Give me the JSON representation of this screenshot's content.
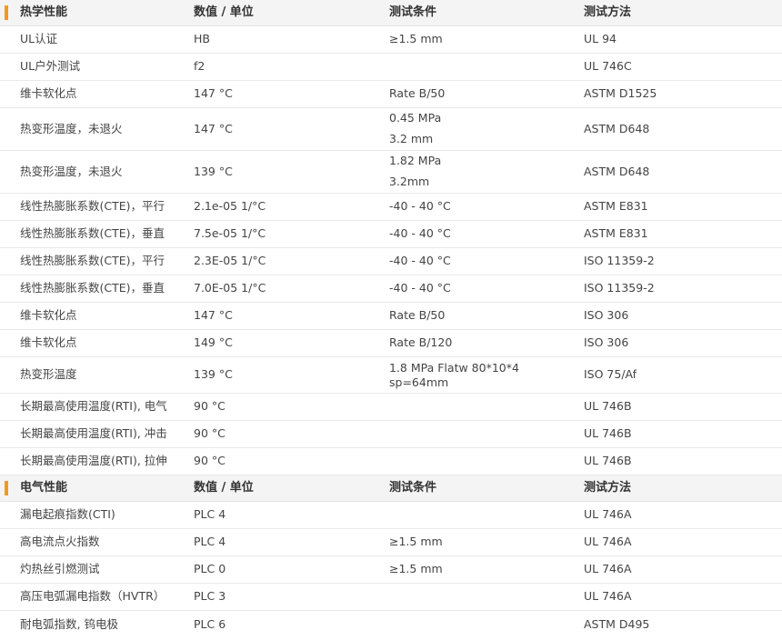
{
  "sections": [
    {
      "title": "热学性能",
      "headers": [
        "数值 / 单位",
        "测试条件",
        "测试方法"
      ],
      "rows": [
        {
          "property": "UL认证",
          "value": "HB",
          "condition": [
            "≥1.5 mm"
          ],
          "method": "UL 94"
        },
        {
          "property": "UL户外测试",
          "value": "f2",
          "condition": [],
          "method": "UL 746C"
        },
        {
          "property": "维卡软化点",
          "value": "147 °C",
          "condition": [
            "Rate B/50"
          ],
          "method": "ASTM D1525"
        },
        {
          "property": "热变形温度，未退火",
          "value": "147 °C",
          "condition": [
            "0.45 MPa",
            "3.2 mm"
          ],
          "method": "ASTM D648"
        },
        {
          "property": "热变形温度，未退火",
          "value": "139 °C",
          "condition": [
            "1.82 MPa",
            "3.2mm"
          ],
          "method": "ASTM D648"
        },
        {
          "property": "线性热膨胀系数(CTE)，平行",
          "value": "2.1e-05 1/°C",
          "condition": [
            "-40 - 40 °C"
          ],
          "method": "ASTM E831"
        },
        {
          "property": "线性热膨胀系数(CTE)，垂直",
          "value": "7.5e-05 1/°C",
          "condition": [
            "-40 - 40 °C"
          ],
          "method": "ASTM E831"
        },
        {
          "property": "线性热膨胀系数(CTE)，平行",
          "value": "2.3E-05 1/°C",
          "condition": [
            "-40 - 40 °C"
          ],
          "method": "ISO 11359-2"
        },
        {
          "property": "线性热膨胀系数(CTE)，垂直",
          "value": "7.0E-05 1/°C",
          "condition": [
            "-40 - 40 °C"
          ],
          "method": "ISO 11359-2"
        },
        {
          "property": "维卡软化点",
          "value": "147 °C",
          "condition": [
            "Rate B/50"
          ],
          "method": "ISO 306"
        },
        {
          "property": "维卡软化点",
          "value": "149 °C",
          "condition": [
            "Rate B/120"
          ],
          "method": "ISO 306"
        },
        {
          "property": "热变形温度",
          "value": "139 °C",
          "condition": [
            "1.8 MPa Flatw 80*10*4",
            "sp=64mm"
          ],
          "method": "ISO 75/Af"
        },
        {
          "property": "长期最高使用温度(RTI), 电气",
          "value": "90 °C",
          "condition": [],
          "method": "UL 746B"
        },
        {
          "property": "长期最高使用温度(RTI), 冲击",
          "value": "90 °C",
          "condition": [],
          "method": "UL 746B"
        },
        {
          "property": "长期最高使用温度(RTI), 拉伸",
          "value": "90 °C",
          "condition": [],
          "method": "UL 746B"
        }
      ]
    },
    {
      "title": "电气性能",
      "headers": [
        "数值 / 单位",
        "测试条件",
        "测试方法"
      ],
      "rows": [
        {
          "property": "漏电起痕指数(CTI)",
          "value": "PLC 4",
          "condition": [],
          "method": "UL 746A"
        },
        {
          "property": "高电流点火指数",
          "value": "PLC 4",
          "condition": [
            "≥1.5 mm"
          ],
          "method": "UL 746A"
        },
        {
          "property": "灼热丝引燃测试",
          "value": "PLC 0",
          "condition": [
            "≥1.5 mm"
          ],
          "method": "UL 746A"
        },
        {
          "property": "高压电弧漏电指数（HVTR）",
          "value": "PLC 3",
          "condition": [],
          "method": "UL 746A"
        },
        {
          "property": "耐电弧指数, 钨电极",
          "value": "PLC 6",
          "condition": [],
          "method": "ASTM D495"
        }
      ]
    }
  ],
  "colors": {
    "accent": "#f39a1e",
    "header_bg": "#f4f4f4",
    "row_border": "#e9e9e9"
  }
}
